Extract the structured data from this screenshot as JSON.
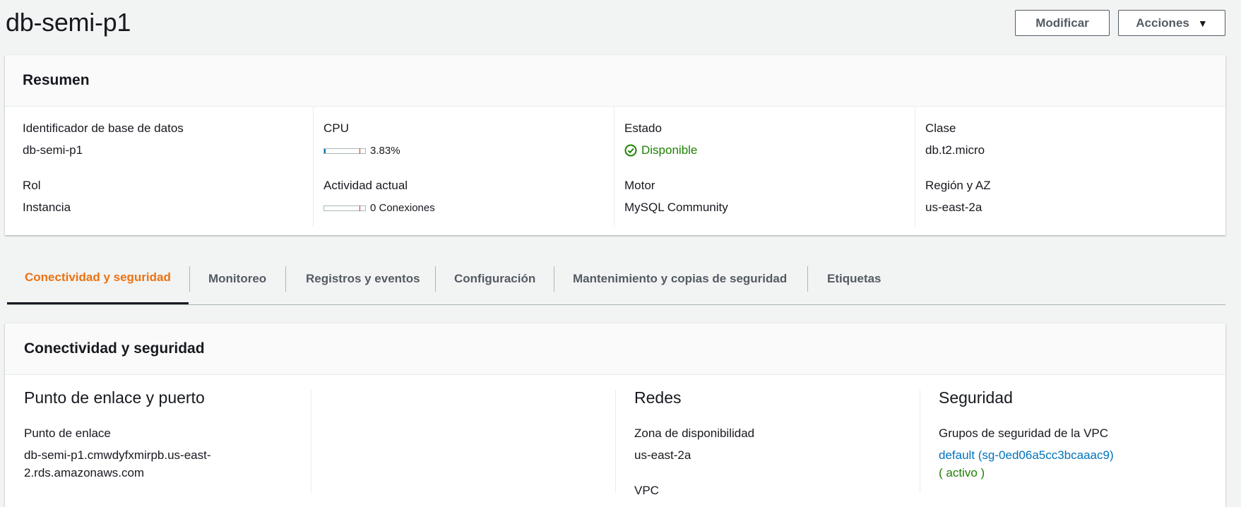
{
  "header": {
    "title": "db-semi-p1",
    "modify_label": "Modificar",
    "actions_label": "Acciones"
  },
  "summary": {
    "title": "Resumen",
    "id_label": "Identificador de base de datos",
    "id_value": "db-semi-p1",
    "cpu_label": "CPU",
    "cpu_value": "3.83%",
    "cpu_fraction": 0.0383,
    "status_label": "Estado",
    "status_value": "Disponible",
    "class_label": "Clase",
    "class_value": "db.t2.micro",
    "role_label": "Rol",
    "role_value": "Instancia",
    "activity_label": "Actividad actual",
    "activity_value": "0 Conexiones",
    "engine_label": "Motor",
    "engine_value": "MySQL Community",
    "region_label": "Región y AZ",
    "region_value": "us-east-2a"
  },
  "tabs": [
    {
      "label": "Conectividad y seguridad",
      "active": true
    },
    {
      "label": "Monitoreo"
    },
    {
      "label": "Registros y eventos"
    },
    {
      "label": "Configuración"
    },
    {
      "label": "Mantenimiento y copias de seguridad"
    },
    {
      "label": "Etiquetas"
    }
  ],
  "connectivity": {
    "title": "Conectividad y seguridad",
    "endpoint_section": "Punto de enlace y puerto",
    "endpoint_label": "Punto de enlace",
    "endpoint_line1": "db-semi-p1.cmwdyfxmirpb.us-east-",
    "endpoint_line2": "2.rds.amazonaws.com",
    "networks_section": "Redes",
    "az_label": "Zona de disponibilidad",
    "az_value": "us-east-2a",
    "vpc_label": "VPC",
    "security_section": "Seguridad",
    "sg_label": "Grupos de seguridad de la VPC",
    "sg_value": "default (sg-0ed06a5cc3bcaaac9)",
    "sg_status": "( activo )"
  },
  "colors": {
    "accent_orange": "#ec7211",
    "link_blue": "#0073bb",
    "status_green": "#1d8102"
  }
}
